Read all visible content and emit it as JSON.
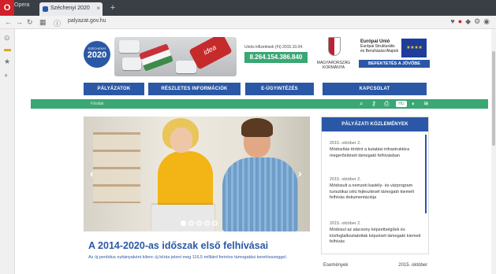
{
  "browser": {
    "menu_label": "Opera",
    "tab_title": "Széchenyi 2020",
    "tab_close": "×",
    "new_tab": "+",
    "url": "palyazat.gov.hu"
  },
  "header": {
    "logo_small": "SZÉCHENYI",
    "logo_big": "2020",
    "idea_key": "idea",
    "counter_label": "Uniós kifizetések (Ft) 2015.10.04.",
    "counter_value": "8.264.154.386.840",
    "gov_line1": "MAGYARORSZÁG",
    "gov_line2": "KORMÁNYA",
    "eu_line1": "Európai Unió",
    "eu_line2": "Európai Strukturális",
    "eu_line3": "és Beruházási Alapok",
    "eu_stars": "★ ★ ★ ★",
    "eu_banner": "BEFEKTETÉS A JÖVŐBE"
  },
  "nav": {
    "items": [
      "PÁLYÁZATOK",
      "RÉSZLETES INFORMÁCIÓK",
      "E-ÜGYINTÉZÉS",
      "KAPCSOLAT"
    ]
  },
  "toolbar": {
    "home": "Főoldal",
    "lang": "HU"
  },
  "slider": {
    "headline": "A 2014-2020-as időszak első felhívásai",
    "subtext": "Az új periódus nyitányaként kilenc új kiírás jelent meg 116,5 milliárd forintos támogatási keretösszeggel."
  },
  "news": {
    "title": "PÁLYÁZATI KÖZLEMÉNYEK",
    "items": [
      {
        "date": "2015. október 2.",
        "text": "Módosítás történt a kutatási infrastruktúra megerősítését támogató felhívásban"
      },
      {
        "date": "2015. október 2.",
        "text": "Módosult a nemzeti kastély- és várprogram turisztikai célú fejlesztését támogató kiemelt felhívás dokumentációja"
      },
      {
        "date": "2015. október 2.",
        "text": "Módosul az alacsony képzettségűek és közfoglalkoztatottak képzését támogató kiemelt felhívás"
      }
    ]
  },
  "events": {
    "label": "Események",
    "date": "2015. október"
  },
  "colors": {
    "brand_blue": "#2b58a6",
    "brand_green": "#3aa774"
  }
}
